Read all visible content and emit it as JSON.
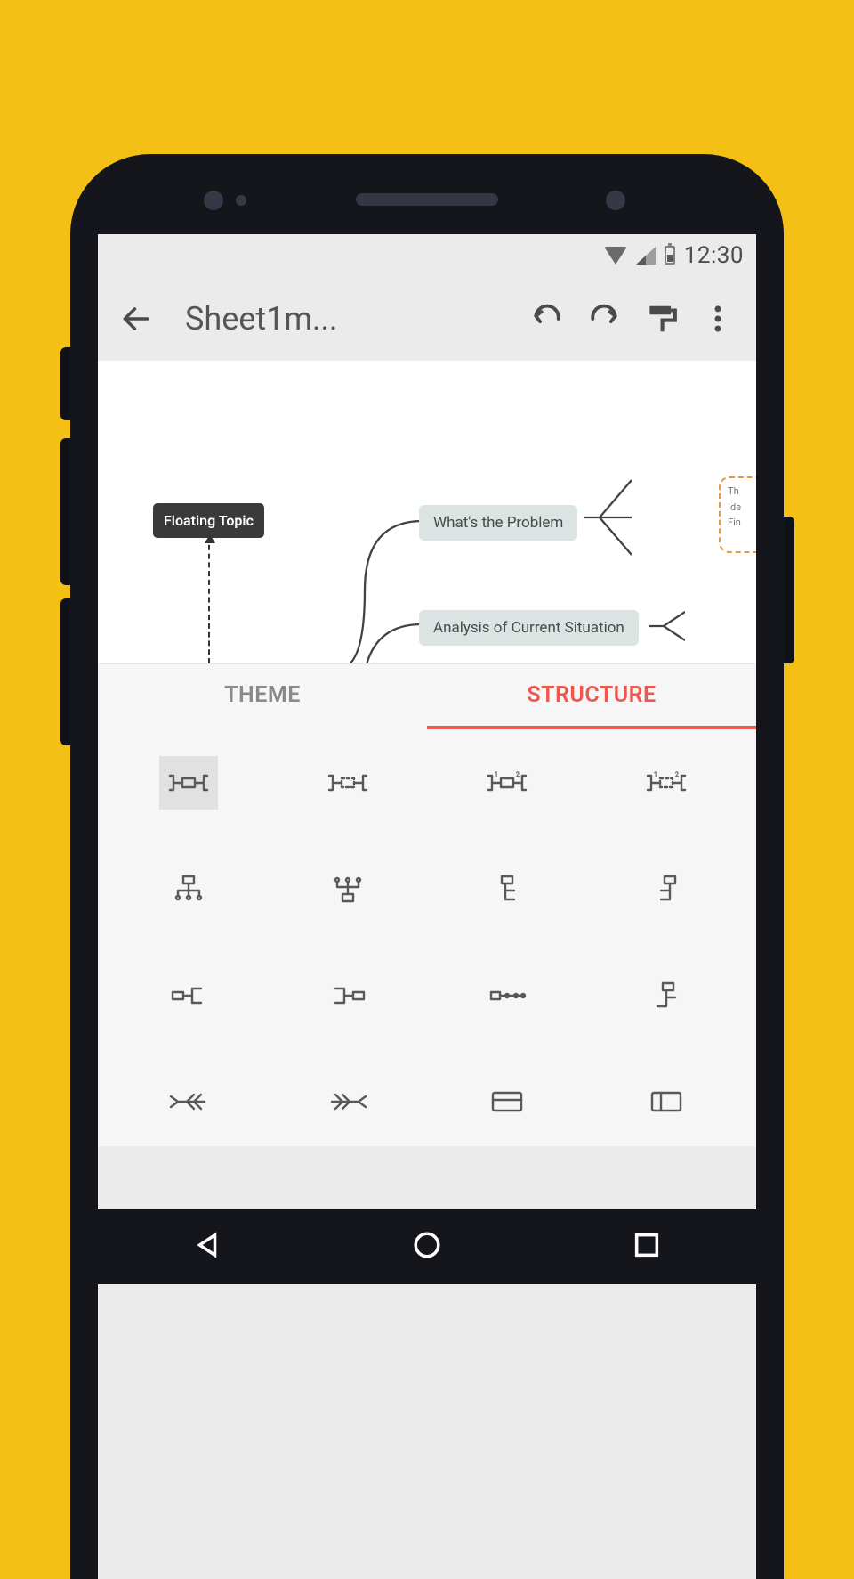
{
  "statusbar": {
    "time": "12:30"
  },
  "appbar": {
    "title": "Sheet1m...",
    "icons": {
      "back": "back-arrow-icon",
      "undo": "undo-icon",
      "redo": "redo-icon",
      "format": "format-paint-icon",
      "more": "more-vertical-icon"
    }
  },
  "canvas": {
    "floating_topic": "Floating Topic",
    "nodes": {
      "n1": "What's the Problem",
      "n2": "Analysis of Current Situation"
    },
    "branch_lines": [
      "Th",
      "Ide",
      "Fin"
    ]
  },
  "tabs": {
    "theme": "THEME",
    "structure": "STRUCTURE",
    "active": "structure"
  },
  "structure_items": [
    {
      "id": "map-balanced",
      "selected": true
    },
    {
      "id": "map-clockwise",
      "selected": false
    },
    {
      "id": "map-anticlockwise",
      "selected": false
    },
    {
      "id": "map-radial",
      "selected": false
    },
    {
      "id": "org-down",
      "selected": false
    },
    {
      "id": "org-up",
      "selected": false
    },
    {
      "id": "tree-right-a",
      "selected": false
    },
    {
      "id": "tree-right-b",
      "selected": false
    },
    {
      "id": "logic-right",
      "selected": false
    },
    {
      "id": "logic-left",
      "selected": false
    },
    {
      "id": "timeline-h",
      "selected": false
    },
    {
      "id": "timeline-v",
      "selected": false
    },
    {
      "id": "fishbone-left",
      "selected": false
    },
    {
      "id": "fishbone-right",
      "selected": false
    },
    {
      "id": "spreadsheet-row",
      "selected": false
    },
    {
      "id": "spreadsheet-col",
      "selected": false
    }
  ],
  "navbar": {
    "back": "android-back-icon",
    "home": "android-home-icon",
    "recent": "android-recent-icon"
  },
  "colors": {
    "accent": "#f0564d",
    "background": "#f5c016",
    "frame": "#14161c"
  }
}
